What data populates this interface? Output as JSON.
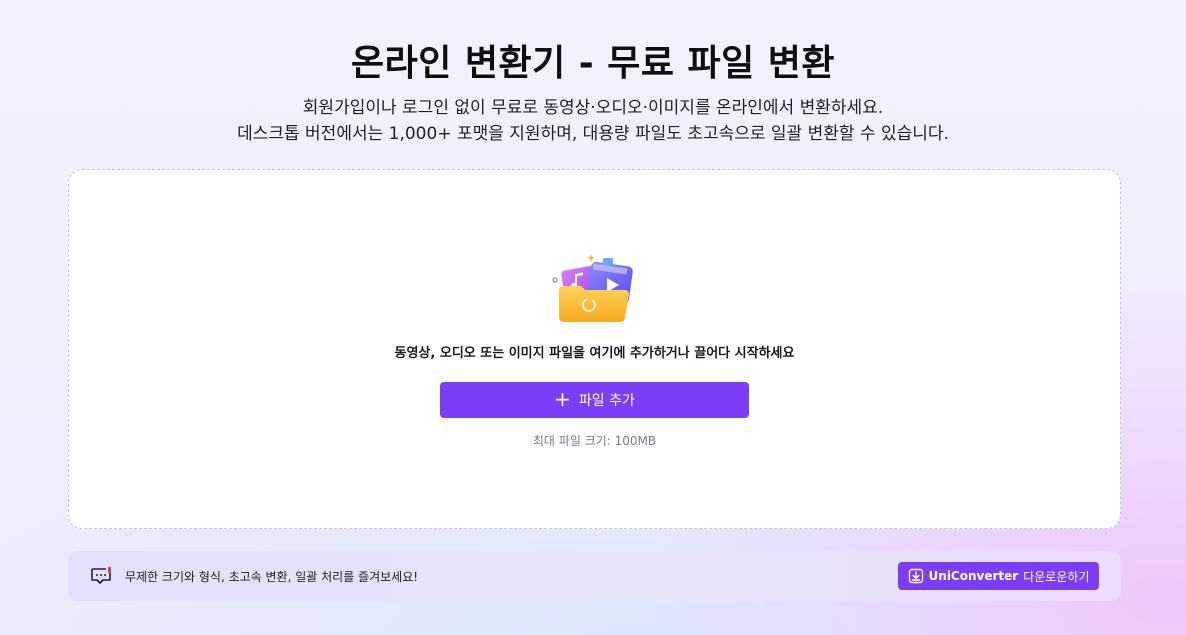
{
  "header": {
    "title": "온라인 변환기 - 무료 파일 변환",
    "subtitle_line1": "회원가입이나 로그인 없이 무료로 동영상·오디오·이미지를 온라인에서 변환하세요.",
    "subtitle_line2": "데스크톱 버전에서는 1,000+ 포맷을 지원하며, 대용량 파일도 초고속으로 일괄 변환할 수 있습니다."
  },
  "drop_zone": {
    "illustration_icon": "folder-media-icon",
    "instruction": "동영상, 오디오 또는 이미지 파일을 여기에 추가하거나 끌어다 시작하세요",
    "add_button_icon": "plus-icon",
    "add_button_label": "파일 추가",
    "max_size": "최대 파일 크기: 100MB"
  },
  "banner": {
    "icon": "chat-bubble-icon",
    "text": "무제한 크기와 형식, 초고속 변환, 일괄 처리를 즐겨보세요!",
    "download_icon": "download-icon",
    "download_brand": "UniConverter",
    "download_label": "다운로운하기"
  },
  "colors": {
    "accent": "#7b3df5",
    "folder": "#fbbf3c",
    "banner_icon_dot": "#e8334a"
  }
}
